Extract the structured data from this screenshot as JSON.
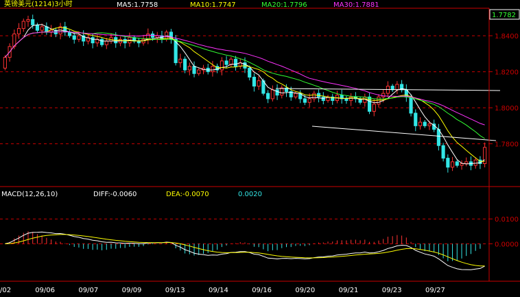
{
  "header": {
    "title": "英镑美元(1214)3小时",
    "ma5": "MA5:1.7758",
    "ma10": "MA10:1.7747",
    "ma20": "MA20:1.7796",
    "ma30": "MA30:1.7881"
  },
  "macd_header": {
    "label": "MACD(12,26,10)",
    "diff": "DIFF:-0.0060",
    "dea": "DEA:-0.0070",
    "macd": "0.0020"
  },
  "colors": {
    "background": "#000000",
    "up": "#ff3333",
    "down": "#33e6e6",
    "ma5": "#ffffff",
    "ma10": "#ffff00",
    "ma20": "#33ff33",
    "ma30": "#ff33ff",
    "grid": "#cc0000",
    "axis_text": "#cc0000",
    "date_text": "#ffffff"
  },
  "chart_data": [
    {
      "type": "candlestick",
      "title": "英镑美元(1214)3小时",
      "ylim": [
        1.757,
        1.8545
      ],
      "y_ticks": [
        1.84,
        1.82,
        1.8,
        1.78
      ],
      "y_tick_labels": [
        "1.8400",
        "1.8200",
        "1.8000",
        "1.7800"
      ],
      "last_price": "1.7782",
      "x_labels": [
        "/02",
        "09/06",
        "09/07",
        "09/09",
        "09/13",
        "09/14",
        "09/16",
        "09/20",
        "09/21",
        "09/23",
        "09/27"
      ],
      "close": [
        1.828,
        1.834,
        1.841,
        1.844,
        1.848,
        1.849,
        1.846,
        1.843,
        1.845,
        1.842,
        1.843,
        1.841,
        1.845,
        1.842,
        1.84,
        1.838,
        1.84,
        1.837,
        1.839,
        1.836,
        1.838,
        1.835,
        1.837,
        1.839,
        1.836,
        1.838,
        1.836,
        1.839,
        1.837,
        1.836,
        1.838,
        1.841,
        1.839,
        1.84,
        1.838,
        1.842,
        1.838,
        1.825,
        1.827,
        1.821,
        1.823,
        1.819,
        1.821,
        1.822,
        1.82,
        1.823,
        1.821,
        1.826,
        1.824,
        1.827,
        1.823,
        1.825,
        1.822,
        1.817,
        1.812,
        1.815,
        1.808,
        1.805,
        1.81,
        1.807,
        1.811,
        1.809,
        1.806,
        1.808,
        1.805,
        1.803,
        1.805,
        1.808,
        1.806,
        1.804,
        1.806,
        1.804,
        1.807,
        1.805,
        1.804,
        1.806,
        1.805,
        1.803,
        1.806,
        1.798,
        1.802,
        1.806,
        1.808,
        1.812,
        1.81,
        1.813,
        1.81,
        1.806,
        1.797,
        1.79,
        1.792,
        1.79,
        1.791,
        1.788,
        1.779,
        1.772,
        1.767,
        1.77,
        1.768,
        1.769,
        1.77,
        1.768,
        1.771,
        1.769,
        1.778
      ]
    },
    {
      "type": "line",
      "title": "MACD(12,26,10)",
      "ylim": [
        -0.0145,
        0.0175
      ],
      "y_ticks": [
        0.01,
        0.0
      ],
      "y_tick_labels": [
        "0.0100",
        "0.0000"
      ],
      "diff": -0.006,
      "dea": -0.007,
      "macd": 0.002
    }
  ]
}
